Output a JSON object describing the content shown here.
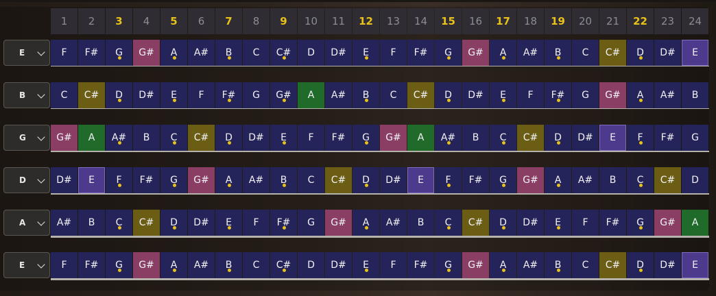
{
  "fret_numbers": [
    "1",
    "2",
    "3",
    "4",
    "5",
    "6",
    "7",
    "8",
    "9",
    "10",
    "11",
    "12",
    "13",
    "14",
    "15",
    "16",
    "17",
    "18",
    "19",
    "20",
    "21",
    "22",
    "23",
    "24"
  ],
  "marker_frets": [
    3,
    5,
    7,
    9,
    12,
    15,
    17,
    19,
    22
  ],
  "dot_frets": [
    3,
    5,
    7,
    9,
    12,
    15,
    17,
    19,
    22
  ],
  "colors": {
    "cell": "#25245a",
    "pink": "#8b3e63",
    "olive": "#6b5e14",
    "green": "#206a2a",
    "purple": "#4e3a8c",
    "marker": "#e8c21a"
  },
  "strings": [
    {
      "tuning": "E",
      "notes": [
        "F",
        "F#",
        "G",
        "G#",
        "A",
        "A#",
        "B",
        "C",
        "C#",
        "D",
        "D#",
        "E",
        "F",
        "F#",
        "G",
        "G#",
        "A",
        "A#",
        "B",
        "C",
        "C#",
        "D",
        "D#",
        "E"
      ],
      "highlights": {
        "4": "pink",
        "16": "pink",
        "21": "olive",
        "24": "purple"
      }
    },
    {
      "tuning": "B",
      "notes": [
        "C",
        "C#",
        "D",
        "D#",
        "E",
        "F",
        "F#",
        "G",
        "G#",
        "A",
        "A#",
        "B",
        "C",
        "C#",
        "D",
        "D#",
        "E",
        "F",
        "F#",
        "G",
        "G#",
        "A",
        "A#",
        "B"
      ],
      "highlights": {
        "2": "olive",
        "10": "green",
        "14": "olive",
        "21": "pink"
      }
    },
    {
      "tuning": "G",
      "notes": [
        "G#",
        "A",
        "A#",
        "B",
        "C",
        "C#",
        "D",
        "D#",
        "E",
        "F",
        "F#",
        "G",
        "G#",
        "A",
        "A#",
        "B",
        "C",
        "C#",
        "D",
        "D#",
        "E",
        "F",
        "F#",
        "G"
      ],
      "highlights": {
        "1": "pink",
        "2": "green",
        "6": "olive",
        "13": "pink",
        "14": "green",
        "18": "olive",
        "21": "purple"
      }
    },
    {
      "tuning": "D",
      "notes": [
        "D#",
        "E",
        "F",
        "F#",
        "G",
        "G#",
        "A",
        "A#",
        "B",
        "C",
        "C#",
        "D",
        "D#",
        "E",
        "F",
        "F#",
        "G",
        "G#",
        "A",
        "A#",
        "B",
        "C",
        "C#",
        "D"
      ],
      "highlights": {
        "2": "purple",
        "6": "pink",
        "11": "olive",
        "14": "purple",
        "18": "pink",
        "23": "olive"
      }
    },
    {
      "tuning": "A",
      "notes": [
        "A#",
        "B",
        "C",
        "C#",
        "D",
        "D#",
        "E",
        "F",
        "F#",
        "G",
        "G#",
        "A",
        "A#",
        "B",
        "C",
        "C#",
        "D",
        "D#",
        "E",
        "F",
        "F#",
        "G",
        "G#",
        "A"
      ],
      "highlights": {
        "4": "olive",
        "11": "pink",
        "16": "olive",
        "23": "pink",
        "24": "green"
      }
    },
    {
      "tuning": "E",
      "notes": [
        "F",
        "F#",
        "G",
        "G#",
        "A",
        "A#",
        "B",
        "C",
        "C#",
        "D",
        "D#",
        "E",
        "F",
        "F#",
        "G",
        "G#",
        "A",
        "A#",
        "B",
        "C",
        "C#",
        "D",
        "D#",
        "E"
      ],
      "highlights": {
        "4": "pink",
        "16": "pink",
        "21": "olive",
        "24": "purple"
      }
    }
  ]
}
